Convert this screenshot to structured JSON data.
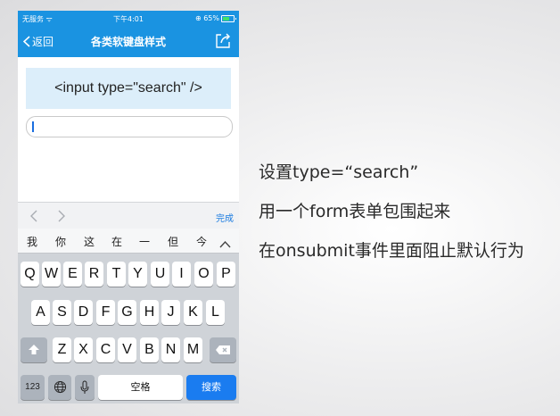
{
  "status_bar": {
    "carrier": "无服务 ᯤ",
    "time": "下午4:01",
    "battery": "⊕ 65%"
  },
  "nav": {
    "back_label": "返回",
    "title": "各类软键盘样式"
  },
  "content": {
    "code_sample": "<input type=\"search\" />",
    "search_value": ""
  },
  "accessory": {
    "done_label": "完成"
  },
  "keyboard": {
    "candidates": [
      "我",
      "你",
      "这",
      "在",
      "一",
      "但",
      "今"
    ],
    "row1": [
      "Q",
      "W",
      "E",
      "R",
      "T",
      "Y",
      "U",
      "I",
      "O",
      "P"
    ],
    "row2": [
      "A",
      "S",
      "D",
      "F",
      "G",
      "H",
      "J",
      "K",
      "L"
    ],
    "row3": [
      "Z",
      "X",
      "C",
      "V",
      "B",
      "N",
      "M"
    ],
    "num_label": "123",
    "space_label": "空格",
    "search_label": "搜索"
  },
  "slide": {
    "lines": [
      "设置type=“search”",
      "用一个form表单包围起来",
      "在onsubmit事件里面阻止默认行为"
    ]
  },
  "colors": {
    "nav_blue": "#1a93e1",
    "action_blue": "#1a7cf0",
    "code_bg": "#dceefa"
  }
}
